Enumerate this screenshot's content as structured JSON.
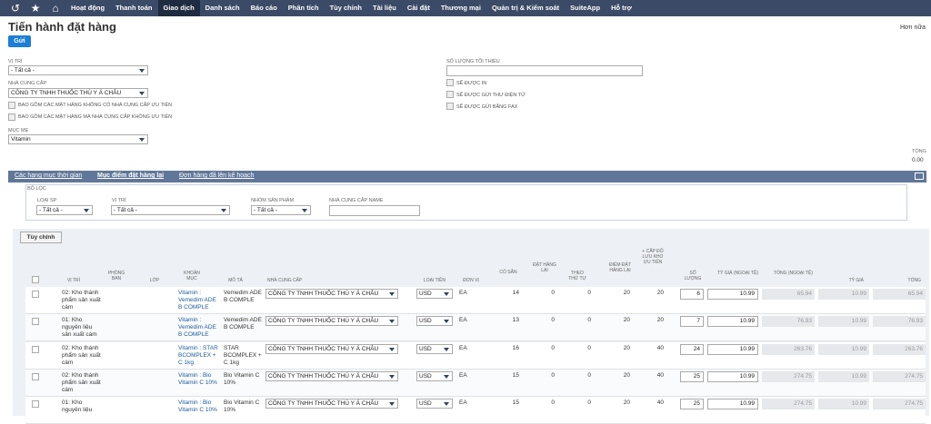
{
  "nav": {
    "items": [
      "Hoạt động",
      "Thanh toán",
      "Giao dịch",
      "Danh sách",
      "Báo cáo",
      "Phân tích",
      "Tùy chỉnh",
      "Tài liệu",
      "Cài đặt",
      "Thương mại",
      "Quản trị & Kiểm soát",
      "SuiteApp",
      "Hỗ trợ"
    ],
    "active": "Giao dịch",
    "icons": [
      "history-icon",
      "star-icon",
      "home-icon"
    ]
  },
  "page": {
    "title": "Tiến hành đặt hàng",
    "more": "Hơn nữa",
    "submit": "Gửi"
  },
  "form": {
    "location_label": "VỊ TRÍ",
    "location_value": "- Tất cả -",
    "vendor_label": "NHÀ CUNG CẤP",
    "vendor_value": "CÔNG TY TNHH THUỐC THÚ Y Á CHÂU",
    "check1": "BAO GỒM CÁC MẶT HÀNG KHÔNG CÓ NHÀ CUNG CẤP ƯU TIÊN",
    "check2": "BAO GỒM CÁC MẶT HÀNG MÀ NHÀ CUNG CẤP KHÔNG ƯU TIÊN",
    "parent_label": "MỤC MẸ",
    "parent_value": "Vitamin",
    "minqty_label": "SỐ LƯỢNG TỐI THIỂU",
    "print": "SẼ ĐƯỢC IN",
    "email": "SẼ ĐƯỢC GỬI THƯ ĐIỆN TỬ",
    "fax": "SẼ ĐƯỢC GỬI BẰNG FAX",
    "total_label": "TỔNG",
    "total_value": "0.00"
  },
  "tabs": [
    "Các hạng mục thời gian",
    "Mục điểm đặt hàng lại",
    "Đơn hàng đã lên kế hoạch"
  ],
  "filters": {
    "title": "BỘ LỌC",
    "type_label": "LOẠI SP",
    "type_value": "- Tất cả -",
    "loc_label": "VỊ TRÍ",
    "loc_value": "- Tất cả -",
    "group_label": "NHÓM SẢN PHẨM",
    "group_value": "- Tất cả -",
    "vendor_name_label": "NHÀ CUNG CẤP NAME"
  },
  "table": {
    "customize": "Tùy chỉnh",
    "headers": [
      "VỊ TRÍ",
      "PHÒNG BAN",
      "LỚP",
      "KHOẢN MỤC",
      "MÔ TẢ",
      "NHÀ CUNG CẤP",
      "LOẠI TIỀN",
      "ĐƠN VỊ",
      "CÓ SẴN",
      "ĐẶT HÀNG LẠI",
      "THEO THỨ TỰ",
      "ĐIỂM ĐẶT HÀNG LẠI",
      "+ CẤP ĐỘ LƯU KHO ƯU TIÊN",
      "SỐ LƯỢNG",
      "TỶ GIÁ (NGOẠI TỆ)",
      "TỔNG (NGOẠI TỆ)",
      "TỶ GIÁ",
      "TỔNG"
    ],
    "rows": [
      {
        "loc": "02: Kho thành phẩm sản xuất cám",
        "item": "Vitamin : Vemedim ADE B COMPLE",
        "desc": "Vemedim ADE B COMPLE",
        "vendor": "CÔNG TY TNHH THUỐC THÚ Y Á CHÂU",
        "cur": "USD",
        "unit": "EA",
        "avail": "14",
        "reorder": "0",
        "onorder": "0",
        "point": "20",
        "pref": "20",
        "qty": "6",
        "rate_fx": "10.99",
        "total_fx": "65.94",
        "rate": "10.99",
        "total": "65.94"
      },
      {
        "loc": "01: Kho nguyên liệu sản xuất cám",
        "item": "Vitamin : Vemedim ADE B COMPLE",
        "desc": "Vemedim ADE B COMPLE",
        "vendor": "CÔNG TY TNHH THUỐC THÚ Y Á CHÂU",
        "cur": "USD",
        "unit": "EA",
        "avail": "13",
        "reorder": "0",
        "onorder": "0",
        "point": "20",
        "pref": "20",
        "qty": "7",
        "rate_fx": "10.99",
        "total_fx": "76.93",
        "rate": "10.99",
        "total": "76.93"
      },
      {
        "loc": "02: Kho thành phẩm sản xuất cám",
        "item": "Vitamin : STAR BCOMPLEX + C 1kg",
        "desc": "STAR BCOMPLEX + C 1kg",
        "vendor": "CÔNG TY TNHH THUỐC THÚ Y Á CHÂU",
        "cur": "USD",
        "unit": "EA",
        "avail": "16",
        "reorder": "0",
        "onorder": "0",
        "point": "20",
        "pref": "40",
        "qty": "24",
        "rate_fx": "10.99",
        "total_fx": "263.76",
        "rate": "10.99",
        "total": "263.76"
      },
      {
        "loc": "02: Kho thành phẩm sản xuất cám",
        "item": "Vitamin : Bio Vitamin C 10%",
        "desc": "Bio Vitamin C 10%",
        "vendor": "CÔNG TY TNHH THUỐC THÚ Y Á CHÂU",
        "cur": "USD",
        "unit": "EA",
        "avail": "15",
        "reorder": "0",
        "onorder": "0",
        "point": "20",
        "pref": "40",
        "qty": "25",
        "rate_fx": "10.99",
        "total_fx": "274.75",
        "rate": "10.99",
        "total": "274.75"
      },
      {
        "loc": "01: Kho nguyên liệu",
        "item": "Vitamin : Bio Vitamin C 10%",
        "desc": "Bio Vitamin C 10%",
        "vendor": "CÔNG TY TNHH THUỐC THÚ Y Á CHÂU",
        "cur": "USD",
        "unit": "EA",
        "avail": "15",
        "reorder": "0",
        "onorder": "0",
        "point": "20",
        "pref": "40",
        "qty": "25",
        "rate_fx": "10.99",
        "total_fx": "274.75",
        "rate": "10.99",
        "total": "274.75"
      }
    ]
  },
  "colors": {
    "nav_bg": "#3b4a66",
    "accent": "#1c7ed6",
    "tab_bg": "#607799"
  }
}
